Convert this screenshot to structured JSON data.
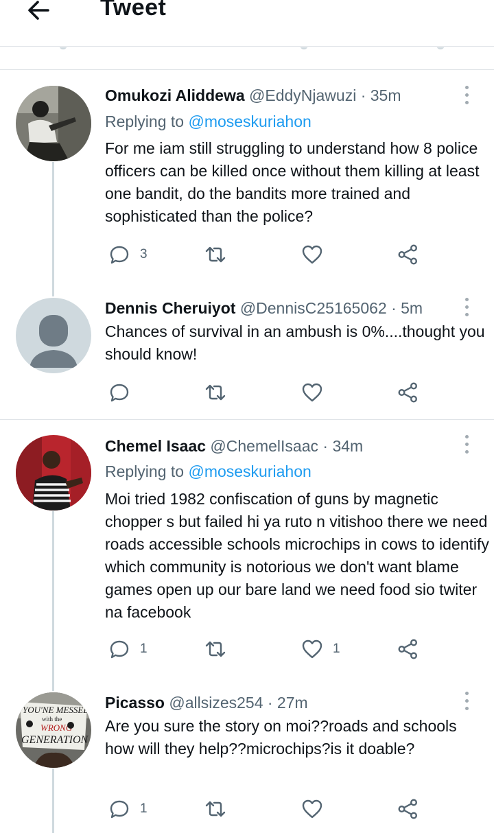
{
  "header": {
    "title": "Tweet"
  },
  "tweets": [
    {
      "name": "Omukozi Aliddewa",
      "handle": "@EddyNjawuzi",
      "time": "· 35m",
      "replying_prefix": "Replying to ",
      "replying_to": "@moseskuriahon",
      "text": "For me iam still struggling to understand how 8 police officers can be killed once without them killing at least one bandit, do the bandits more trained and sophisticated than the police?",
      "reply_count": "3",
      "retweet_count": "",
      "like_count": ""
    },
    {
      "name": "Dennis Cheruiyot",
      "handle": "@DennisC25165062",
      "time": "· 5m",
      "text": "Chances of survival in an ambush is 0%....thought you should know!",
      "reply_count": "",
      "retweet_count": "",
      "like_count": ""
    },
    {
      "name": "Chemel Isaac",
      "handle": "@ChemelIsaac",
      "time": "· 34m",
      "replying_prefix": "Replying to ",
      "replying_to": "@moseskuriahon",
      "text": "Moi tried 1982  confiscation of guns by magnetic chopper s but failed hi ya ruto n vitishoo  there we need roads accessible schools microchips in cows to identify which community is notorious we don't want blame games open up our bare land we need food sio twiter na facebook",
      "reply_count": "1",
      "retweet_count": "",
      "like_count": "1"
    },
    {
      "name": "Picasso",
      "handle": "@allsizes254",
      "time": "· 27m",
      "text": "Are you sure the story on moi??roads and schools how will they help??microchips?is it doable?",
      "reply_count": "1",
      "retweet_count": "",
      "like_count": ""
    }
  ],
  "avatar_sign_text": [
    "YOU'NE MESSED",
    "with the",
    "WRONG",
    "GENERATION"
  ],
  "colors": {
    "link": "#1d9bf0",
    "secondary_text": "#536471",
    "divider": "#dfe3e7",
    "thread_line": "#cfd9de"
  },
  "icons": [
    "back-arrow-icon",
    "more-icon",
    "reply-icon",
    "retweet-icon",
    "like-icon",
    "share-icon"
  ]
}
